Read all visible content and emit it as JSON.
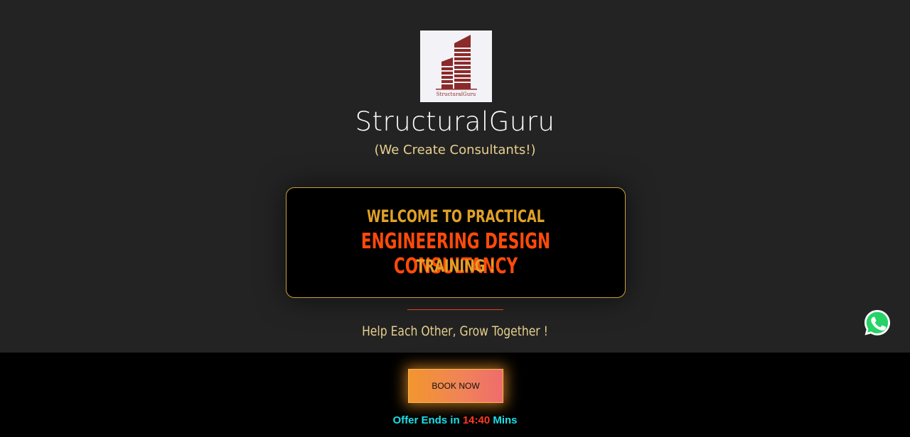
{
  "brand": {
    "logo_text": "StructuralGuru",
    "name": "StructuralGuru",
    "tagline": "(We Create Consultants!)"
  },
  "hero": {
    "line1": "WELCOME TO PRACTICAL",
    "line2": "ENGINEERING DESIGN CONSULTANCY",
    "line3": "TRAINING !"
  },
  "motto": "Help Each Other, Grow Together !",
  "cta": {
    "book_label": "BOOK NOW",
    "offer_prefix": "Offer Ends in",
    "offer_timer": "14:40",
    "offer_suffix": "Mins"
  },
  "floating": {
    "whatsapp_icon": "whatsapp-icon"
  },
  "colors": {
    "background": "#232323",
    "footer_background": "#000000",
    "accent_gold": "#e0a127",
    "accent_red": "#ff4a0a",
    "offer_cyan": "#19e0e8",
    "logo_red": "#8b2a2a",
    "whatsapp_green": "#25d366"
  }
}
